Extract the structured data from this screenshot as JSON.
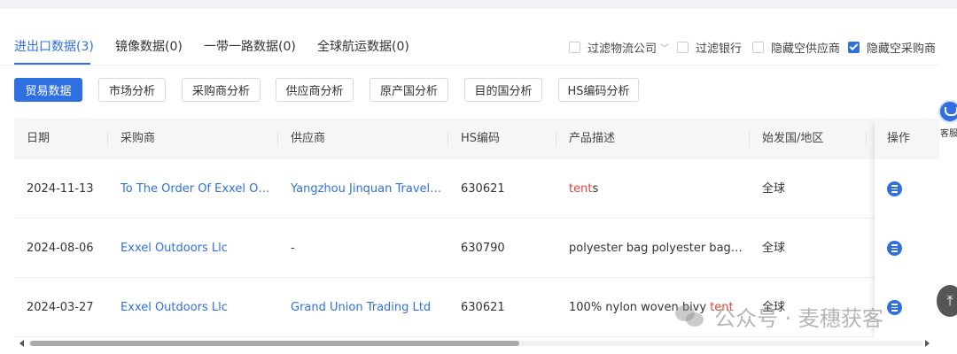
{
  "tabs": [
    {
      "label": "进出口数据(3)",
      "active": true
    },
    {
      "label": "镜像数据(0)",
      "active": false
    },
    {
      "label": "一带一路数据(0)",
      "active": false
    },
    {
      "label": "全球航运数据(0)",
      "active": false
    }
  ],
  "filters": [
    {
      "label": "过滤物流公司",
      "checked": false,
      "has_dropdown": true
    },
    {
      "label": "过滤银行",
      "checked": false
    },
    {
      "label": "隐藏空供应商",
      "checked": false
    },
    {
      "label": "隐藏空采购商",
      "checked": true
    }
  ],
  "subtabs": [
    {
      "label": "贸易数据",
      "active": true
    },
    {
      "label": "市场分析",
      "active": false
    },
    {
      "label": "采购商分析",
      "active": false
    },
    {
      "label": "供应商分析",
      "active": false
    },
    {
      "label": "原产国分析",
      "active": false
    },
    {
      "label": "目的国分析",
      "active": false
    },
    {
      "label": "HS编码分析",
      "active": false
    }
  ],
  "table": {
    "headers": [
      "日期",
      "采购商",
      "供应商",
      "HS编码",
      "产品描述",
      "始发国/地区",
      "操作"
    ],
    "rows": [
      {
        "date": "2024-11-13",
        "buyer": "To The Order Of Exxel Outdo...",
        "supplier": "Yangzhou Jinquan Travelling ...",
        "hs": "630621",
        "desc_pre": "",
        "desc_hl": "tent",
        "desc_post": "s",
        "origin": "全球"
      },
      {
        "date": "2024-08-06",
        "buyer": "Exxel Outdoors Llc",
        "supplier": "-",
        "hs": "630790",
        "desc_pre": "polyester bag polyester bag slee...",
        "desc_hl": "",
        "desc_post": "",
        "origin": "全球"
      },
      {
        "date": "2024-03-27",
        "buyer": "Exxel Outdoors Llc",
        "supplier": "Grand Union Trading Ltd",
        "hs": "630621",
        "desc_pre": "100% nylon woven bivy ",
        "desc_hl": "tent",
        "desc_post": "",
        "origin": "全球"
      }
    ]
  },
  "customer_service": {
    "label": "客服"
  },
  "watermark": {
    "text": "公众号 · 麦穗获客"
  },
  "colors": {
    "accent": "#2f6fe0",
    "highlight": "#e0403a"
  }
}
